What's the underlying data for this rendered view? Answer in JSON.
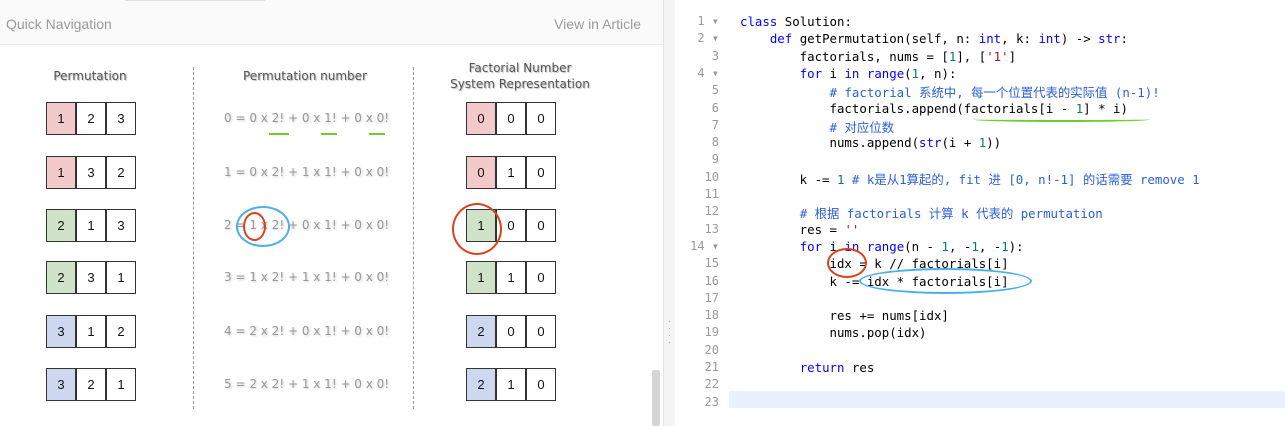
{
  "left_panel": {
    "quick_nav": "Quick Navigation",
    "view_article": "View in Article",
    "figure": {
      "col1": "Permutation",
      "col2": "Permutation number",
      "col3a": "Factorial Number",
      "col3b": "System Representation",
      "rows": [
        {
          "color": "red",
          "perm": [
            "1",
            "2",
            "3"
          ],
          "formula": "0 = 0 x 2! + 0 x 1! + 0 x 0!",
          "fact": [
            "0",
            "0",
            "0"
          ]
        },
        {
          "color": "red",
          "perm": [
            "1",
            "3",
            "2"
          ],
          "formula": "1 = 0 x 2! + 1 x 1! + 0 x 0!",
          "fact": [
            "0",
            "1",
            "0"
          ]
        },
        {
          "color": "green",
          "perm": [
            "2",
            "1",
            "3"
          ],
          "formula": "2 = 1 x 2! + 0 x 1! + 0 x 0!",
          "fact": [
            "1",
            "0",
            "0"
          ]
        },
        {
          "color": "green",
          "perm": [
            "2",
            "3",
            "1"
          ],
          "formula": "3 = 1 x 2! + 1 x 1! + 0 x 0!",
          "fact": [
            "1",
            "1",
            "0"
          ]
        },
        {
          "color": "blue",
          "perm": [
            "3",
            "1",
            "2"
          ],
          "formula": "4 = 2 x 2! + 0 x 1! + 0 x 0!",
          "fact": [
            "2",
            "0",
            "0"
          ]
        },
        {
          "color": "blue",
          "perm": [
            "3",
            "2",
            "1"
          ],
          "formula": "5 = 2 x 2! + 1 x 1! + 0 x 0!",
          "fact": [
            "2",
            "1",
            "0"
          ]
        }
      ]
    }
  },
  "editor": {
    "lines": [
      {
        "n": "1",
        "fold": true,
        "html": "<span class='kw'>class</span> Solution:"
      },
      {
        "n": "2",
        "fold": true,
        "html": "    <span class='kw'>def</span> getPermutation(self, n: <span class='kw'>int</span>, k: <span class='kw'>int</span>) -> <span class='kw'>str</span>:"
      },
      {
        "n": "3",
        "fold": false,
        "html": "        factorials, nums = [<span class='num'>1</span>], [<span class='str'>'1'</span>]"
      },
      {
        "n": "4",
        "fold": true,
        "html": "        <span class='kw'>for</span> i <span class='kw'>in</span> <span class='kw'>range</span>(<span class='num'>1</span>, n):"
      },
      {
        "n": "5",
        "fold": false,
        "html": "            <span class='cm'># factorial 系统中, 每一个位置代表的实际值 (n-1)!</span>"
      },
      {
        "n": "6",
        "fold": false,
        "html": "            factorials.append(factorials[i - <span class='num'>1</span>] * i)"
      },
      {
        "n": "7",
        "fold": false,
        "html": "            <span class='cm'># 对应位数</span>"
      },
      {
        "n": "8",
        "fold": false,
        "html": "            nums.append(<span class='kw'>str</span>(i + <span class='num'>1</span>))"
      },
      {
        "n": "9",
        "fold": false,
        "html": ""
      },
      {
        "n": "10",
        "fold": false,
        "html": "        k -= <span class='num'>1</span> <span class='cm'># k是从1算起的, fit 进 [0, n!-1] 的话需要 remove 1</span>"
      },
      {
        "n": "11",
        "fold": false,
        "html": ""
      },
      {
        "n": "12",
        "fold": false,
        "html": "        <span class='cm'># 根据 factorials 计算 k 代表的 permutation</span>"
      },
      {
        "n": "13",
        "fold": false,
        "html": "        res = <span class='str'>''</span>"
      },
      {
        "n": "14",
        "fold": true,
        "html": "        <span class='kw'>for</span> i <span class='kw'>in</span> <span class='kw'>range</span>(n - <span class='num'>1</span>, -<span class='num'>1</span>, -<span class='num'>1</span>):"
      },
      {
        "n": "15",
        "fold": false,
        "html": "            idx = k // factorials[i]"
      },
      {
        "n": "16",
        "fold": false,
        "html": "            k -= idx * factorials[i]"
      },
      {
        "n": "17",
        "fold": false,
        "html": ""
      },
      {
        "n": "18",
        "fold": false,
        "html": "            res += nums[idx]"
      },
      {
        "n": "19",
        "fold": false,
        "html": "            nums.pop(idx)"
      },
      {
        "n": "20",
        "fold": false,
        "html": ""
      },
      {
        "n": "21",
        "fold": false,
        "html": "        <span class='kw'>return</span> res"
      },
      {
        "n": "22",
        "fold": false,
        "html": ""
      },
      {
        "n": "23",
        "fold": false,
        "html": ""
      }
    ]
  }
}
